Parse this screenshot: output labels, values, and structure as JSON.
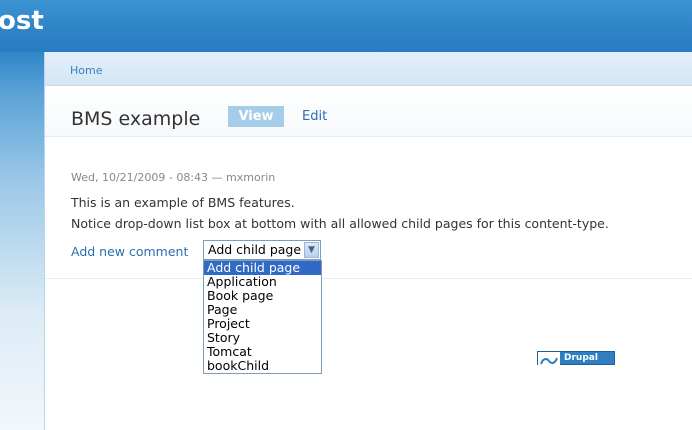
{
  "header": {
    "site_name_fragment": "ost"
  },
  "breadcrumb": {
    "home": "Home"
  },
  "node": {
    "title": "BMS example",
    "tabs": [
      {
        "label": "View",
        "active": true
      },
      {
        "label": "Edit",
        "active": false
      }
    ],
    "submitted": "Wed, 10/21/2009 - 08:43 — mxmorin",
    "body": [
      "This is an example of BMS features.",
      "Notice drop-down list box at bottom with all allowed child pages for this content-type."
    ],
    "links": {
      "add_comment": "Add new comment"
    }
  },
  "child_page_select": {
    "value": "Add child page",
    "expanded": true,
    "options": [
      {
        "label": "Add child page",
        "highlighted": true
      },
      {
        "label": "Application"
      },
      {
        "label": "Book page"
      },
      {
        "label": "Page"
      },
      {
        "label": "Project"
      },
      {
        "label": "Story"
      },
      {
        "label": "Tomcat"
      },
      {
        "label": "bookChild"
      }
    ]
  },
  "footer": {
    "badge": "Drupal"
  },
  "colors": {
    "header_blue": "#2e82c6",
    "link_blue": "#2a6eb5",
    "tab_active": "#a5cce8",
    "option_highlight": "#3169c6"
  }
}
